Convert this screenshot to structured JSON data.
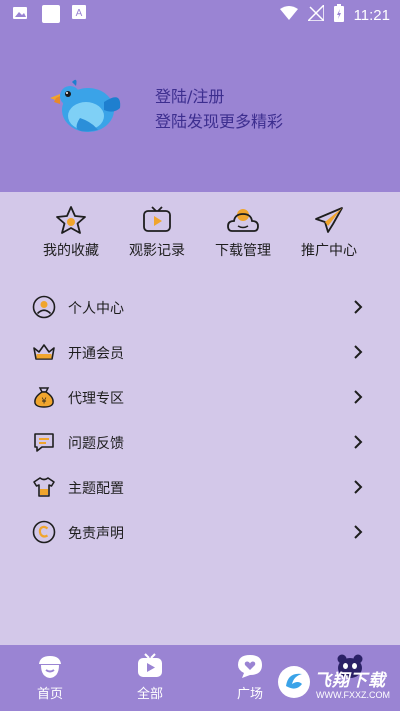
{
  "status_bar": {
    "time": "11:21",
    "left_icons": [
      "image-icon",
      "square-icon",
      "font-a-icon"
    ],
    "right_icons": [
      "wifi-icon",
      "no-signal-icon",
      "battery-charging-icon"
    ]
  },
  "profile": {
    "title": "登陆/注册",
    "subtitle": "登陆发现更多精彩",
    "avatar_icon": "bird-avatar"
  },
  "quick_actions": [
    {
      "label": "我的收藏",
      "icon": "star-icon"
    },
    {
      "label": "观影记录",
      "icon": "tv-play-icon"
    },
    {
      "label": "下载管理",
      "icon": "cloud-sun-icon"
    },
    {
      "label": "推广中心",
      "icon": "paper-plane-icon"
    }
  ],
  "menu": [
    {
      "label": "个人中心",
      "icon": "user-circle-icon"
    },
    {
      "label": "开通会员",
      "icon": "crown-icon"
    },
    {
      "label": "代理专区",
      "icon": "money-bag-icon"
    },
    {
      "label": "问题反馈",
      "icon": "chat-bubble-icon"
    },
    {
      "label": "主题配置",
      "icon": "tshirt-icon"
    },
    {
      "label": "免责声明",
      "icon": "copyright-icon"
    }
  ],
  "tabs": [
    {
      "label": "首页",
      "icon": "acorn-icon"
    },
    {
      "label": "全部",
      "icon": "tv-play-icon"
    },
    {
      "label": "广场",
      "icon": "heart-bubble-icon"
    },
    {
      "label": "",
      "icon": "panda-icon"
    }
  ],
  "watermark": {
    "text": "飞翔下载",
    "url": "WWW.FXXZ.COM"
  },
  "colors": {
    "header_bg": "#9a84d3",
    "page_bg": "#d3c8e9",
    "title_text": "#3d2e8f",
    "accent_orange": "#f0a52d"
  }
}
